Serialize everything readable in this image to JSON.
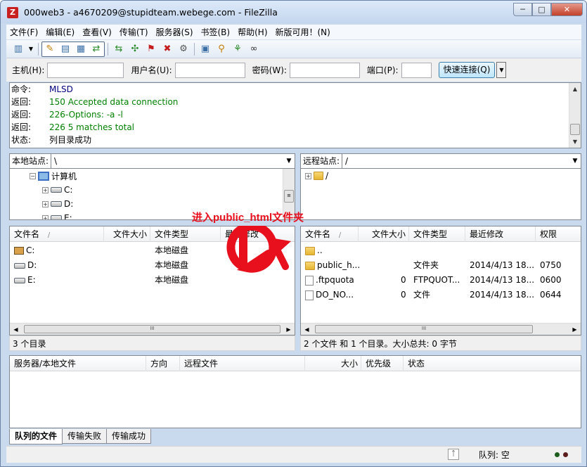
{
  "window": {
    "title": "000web3 - a4670209@stupidteam.webege.com - FileZilla",
    "controls": [
      "─",
      "□",
      "✕"
    ]
  },
  "menu": [
    "文件(F)",
    "编辑(E)",
    "查看(V)",
    "传输(T)",
    "服务器(S)",
    "书签(B)",
    "帮助(H)",
    "新版可用！(N)"
  ],
  "quickconnect": {
    "host_label": "主机(H):",
    "user_label": "用户名(U):",
    "pass_label": "密码(W):",
    "port_label": "端口(P):",
    "host_value": "",
    "user_value": "",
    "pass_value": "",
    "port_value": "",
    "button": "快速连接(Q)"
  },
  "log": [
    {
      "k": "命令:",
      "v": "MLSD",
      "type": "cmd"
    },
    {
      "k": "返回:",
      "v": "150 Accepted data connection",
      "type": "resp"
    },
    {
      "k": "返回:",
      "v": "226-Options: -a -l",
      "type": "resp"
    },
    {
      "k": "返回:",
      "v": "226 5 matches total",
      "type": "resp"
    },
    {
      "k": "状态:",
      "v": "列目录成功",
      "type": "status"
    }
  ],
  "local": {
    "site_label": "本地站点:",
    "path": "\\",
    "tree": [
      {
        "label": "计算机",
        "icon": "computer-icon"
      },
      {
        "label": "C:",
        "icon": "drive-icon"
      },
      {
        "label": "D:",
        "icon": "drive-icon"
      },
      {
        "label": "E:",
        "icon": "drive-icon"
      }
    ],
    "headers": [
      "文件名",
      "文件大小",
      "文件类型",
      "最近修改"
    ],
    "sort_glyph": "/",
    "rows": [
      {
        "name": "C:",
        "size": "",
        "type": "本地磁盘",
        "icon": "system-drive-icon"
      },
      {
        "name": "D:",
        "size": "",
        "type": "本地磁盘",
        "icon": "drive-icon"
      },
      {
        "name": "E:",
        "size": "",
        "type": "本地磁盘",
        "icon": "drive-icon"
      }
    ],
    "status": "3 个目录"
  },
  "remote": {
    "site_label": "远程站点:",
    "path": "/",
    "tree": [
      {
        "label": "/",
        "icon": "folder-icon"
      }
    ],
    "headers": [
      "文件名",
      "文件大小",
      "文件类型",
      "最近修改",
      "权限"
    ],
    "sort_glyph": "/",
    "rows": [
      {
        "name": "..",
        "size": "",
        "type": "",
        "modified": "",
        "perm": "",
        "icon": "folder-icon"
      },
      {
        "name": "public_h...",
        "size": "",
        "type": "文件夹",
        "modified": "2014/4/13 18...",
        "perm": "0750",
        "icon": "folder-icon"
      },
      {
        "name": ".ftpquota",
        "size": "0",
        "type": "FTPQUOT...",
        "modified": "2014/4/13 18...",
        "perm": "0600",
        "icon": "file-icon"
      },
      {
        "name": "DO_NO...",
        "size": "0",
        "type": "文件",
        "modified": "2014/4/13 18...",
        "perm": "0644",
        "icon": "file-icon"
      }
    ],
    "status": "2 个文件 和 1 个目录。大小总共: 0 字节"
  },
  "annotation": "进入public_html文件夹",
  "queue": {
    "headers": [
      "服务器/本地文件",
      "方向",
      "远程文件",
      "大小",
      "优先级",
      "状态"
    ],
    "tabs": [
      "队列的文件",
      "传输失败",
      "传输成功"
    ],
    "queue_status": "队列: 空"
  },
  "scroll_glyph": "III",
  "colors": {
    "annotation": "#e8101c",
    "command_text": "#000080",
    "response_text": "#008000"
  }
}
